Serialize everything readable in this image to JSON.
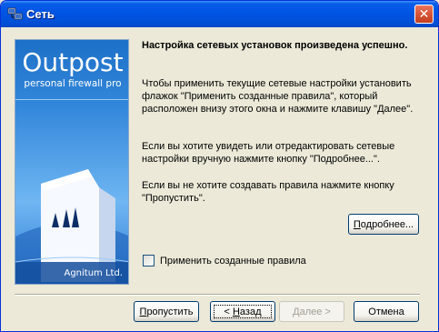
{
  "window": {
    "title": "Сеть",
    "close_glyph": "✕",
    "icon": "network-settings-icon"
  },
  "banner": {
    "brand": "Outpost",
    "subtitle": "personal firewall pro",
    "company": "Agnitum Ltd."
  },
  "content": {
    "heading": "Настройка сетевых установок произведена успешно.",
    "paragraph1": "Чтобы применить текущие сетевые настройки установить флажок  \"Применить созданные правила\", который расположен внизу этого окна и нажмите клавишу \"Далее\".",
    "paragraph2": "Если вы хотите увидеть или отредактировать сетевые настройки вручную нажмите кнопку \"Подробнее...\".",
    "paragraph3": "Если вы не хотите создавать правила нажмите кнопку \"Пропустить\"."
  },
  "details_button": {
    "mnemonic": "П",
    "rest": "одробнее..."
  },
  "checkbox": {
    "label": "Применить созданные правила",
    "checked": false
  },
  "buttons": {
    "skip": {
      "mnemonic": "П",
      "rest": "ропустить"
    },
    "back": {
      "prefix": "< ",
      "mnemonic": "Н",
      "rest": "азад"
    },
    "next": {
      "mnemonic": "Д",
      "rest": "алее >"
    },
    "cancel": "Отмена"
  },
  "colors": {
    "titlebar": "#0054e3",
    "close": "#d75437",
    "banner": "#3a8ee0",
    "dialog_bg": "#ece9d8"
  }
}
